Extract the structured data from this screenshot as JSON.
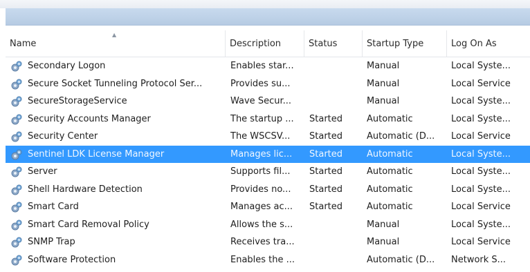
{
  "columns": {
    "name": "Name",
    "description": "Description",
    "status": "Status",
    "startup_type": "Startup Type",
    "log_on_as": "Log On As"
  },
  "sort_indicator": "▲",
  "icon": "service-gear-icon",
  "selection_color": "#3399ff",
  "rows": [
    {
      "name": "Secondary Logon",
      "description": "Enables star...",
      "status": "",
      "startup_type": "Manual",
      "log_on_as": "Local Syste..."
    },
    {
      "name": "Secure Socket Tunneling Protocol Ser...",
      "description": "Provides su...",
      "status": "",
      "startup_type": "Manual",
      "log_on_as": "Local Service"
    },
    {
      "name": "SecureStorageService",
      "description": "Wave Secur...",
      "status": "",
      "startup_type": "Manual",
      "log_on_as": "Local Syste..."
    },
    {
      "name": "Security Accounts Manager",
      "description": "The startup ...",
      "status": "Started",
      "startup_type": "Automatic",
      "log_on_as": "Local Syste..."
    },
    {
      "name": "Security Center",
      "description": "The WSCSV...",
      "status": "Started",
      "startup_type": "Automatic (D...",
      "log_on_as": "Local Service"
    },
    {
      "name": "Sentinel LDK License Manager",
      "description": "Manages lic...",
      "status": "Started",
      "startup_type": "Automatic",
      "log_on_as": "Local Syste...",
      "selected": true
    },
    {
      "name": "Server",
      "description": "Supports fil...",
      "status": "Started",
      "startup_type": "Automatic",
      "log_on_as": "Local Syste..."
    },
    {
      "name": "Shell Hardware Detection",
      "description": "Provides no...",
      "status": "Started",
      "startup_type": "Automatic",
      "log_on_as": "Local Syste..."
    },
    {
      "name": "Smart Card",
      "description": "Manages ac...",
      "status": "Started",
      "startup_type": "Automatic",
      "log_on_as": "Local Service"
    },
    {
      "name": "Smart Card Removal Policy",
      "description": "Allows the s...",
      "status": "",
      "startup_type": "Manual",
      "log_on_as": "Local Syste..."
    },
    {
      "name": "SNMP Trap",
      "description": "Receives tra...",
      "status": "",
      "startup_type": "Manual",
      "log_on_as": "Local Service"
    },
    {
      "name": "Software Protection",
      "description": "Enables the ...",
      "status": "",
      "startup_type": "Automatic (D...",
      "log_on_as": "Network S..."
    }
  ]
}
